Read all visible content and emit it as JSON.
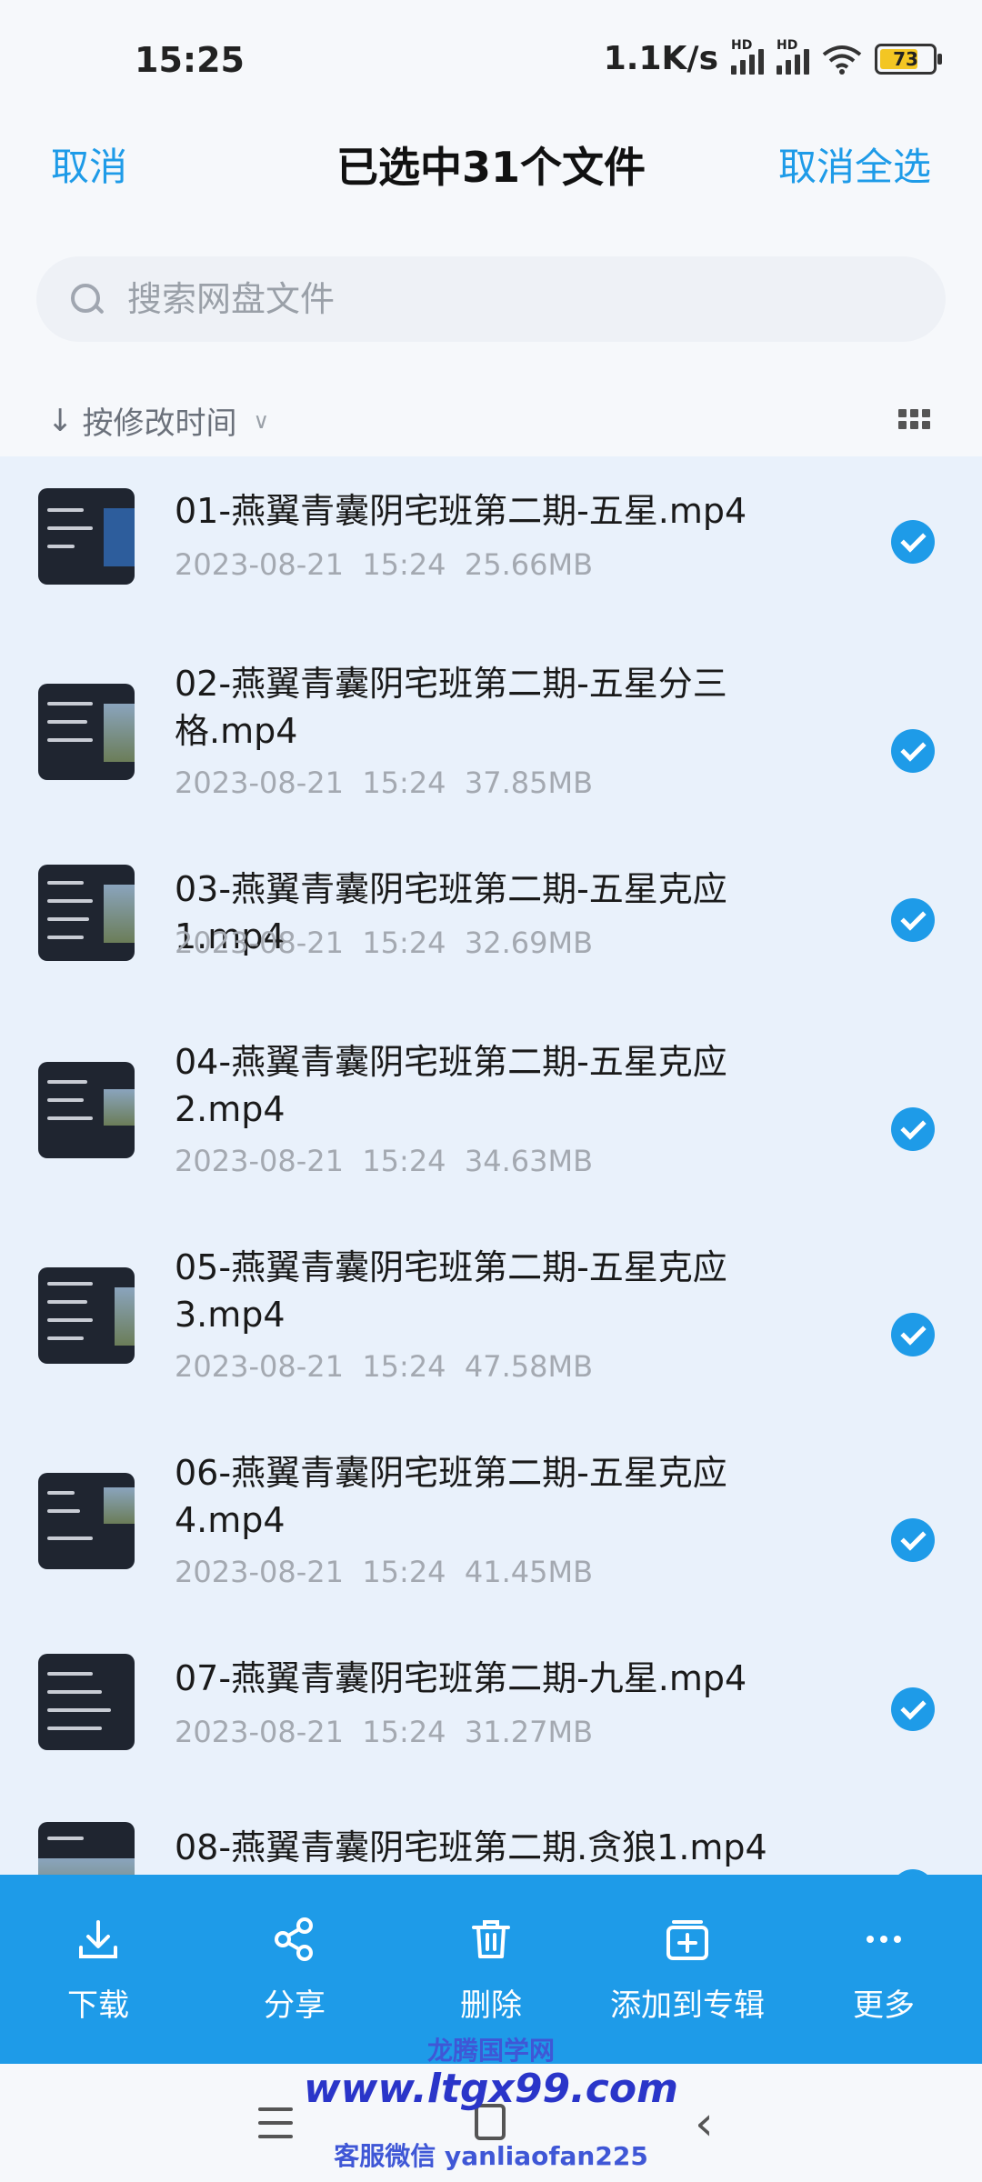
{
  "status": {
    "time": "15:25",
    "speed": "1.1K/s",
    "battery": "73",
    "battery_level": 0.73
  },
  "header": {
    "cancel": "取消",
    "title": "已选中31个文件",
    "deselect_all": "取消全选"
  },
  "search": {
    "placeholder": "搜索网盘文件"
  },
  "sort": {
    "label": "按修改时间"
  },
  "files": [
    {
      "name": "01-燕翼青囊阴宅班第二期-五星.mp4",
      "date": "2023-08-21",
      "time": "15:24",
      "size": "25.66MB",
      "checked": true
    },
    {
      "name": "02-燕翼青囊阴宅班第二期-五星分三格.mp4",
      "date": "2023-08-21",
      "time": "15:24",
      "size": "37.85MB",
      "checked": true
    },
    {
      "name": "03-燕翼青囊阴宅班第二期-五星克应1.mp4",
      "date": "2023-08-21",
      "time": "15:24",
      "size": "32.69MB",
      "checked": true
    },
    {
      "name": "04-燕翼青囊阴宅班第二期-五星克应2.mp4",
      "date": "2023-08-21",
      "time": "15:24",
      "size": "34.63MB",
      "checked": true
    },
    {
      "name": "05-燕翼青囊阴宅班第二期-五星克应3.mp4",
      "date": "2023-08-21",
      "time": "15:24",
      "size": "47.58MB",
      "checked": true
    },
    {
      "name": "06-燕翼青囊阴宅班第二期-五星克应4.mp4",
      "date": "2023-08-21",
      "time": "15:24",
      "size": "41.45MB",
      "checked": true
    },
    {
      "name": "07-燕翼青囊阴宅班第二期-九星.mp4",
      "date": "2023-08-21",
      "time": "15:24",
      "size": "31.27MB",
      "checked": true
    },
    {
      "name": "08-燕翼青囊阴宅班第二期.贪狼1.mp4",
      "date": "",
      "time": "",
      "size": "",
      "checked": true
    }
  ],
  "actions": {
    "download": "下载",
    "share": "分享",
    "delete": "删除",
    "add_to_album": "添加到专辑",
    "more": "更多"
  },
  "watermark": {
    "name": "龙腾国学网",
    "site": "www.ltgx99.com",
    "contact": "客服微信 yanliaofan225"
  }
}
